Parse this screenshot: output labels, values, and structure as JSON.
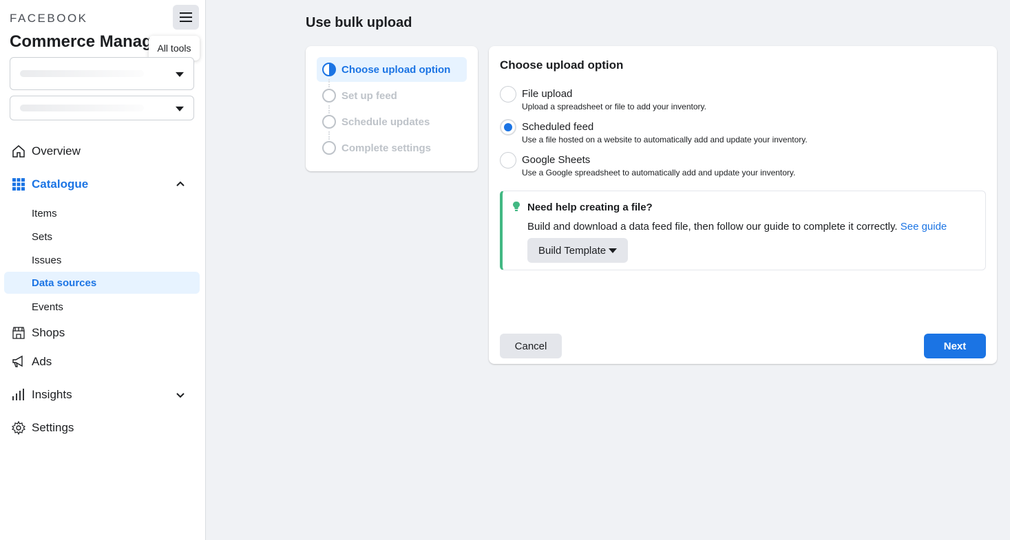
{
  "brand": "FACEBOOK",
  "app_title": "Commerce Manager",
  "tooltip": "All tools",
  "sidebar": {
    "nav": [
      {
        "label": "Overview",
        "icon": "home-icon"
      },
      {
        "label": "Catalogue",
        "icon": "grid-icon",
        "active": true,
        "expanded": true
      },
      {
        "label": "Shops",
        "icon": "shop-icon"
      },
      {
        "label": "Ads",
        "icon": "megaphone-icon"
      },
      {
        "label": "Insights",
        "icon": "bar-chart-icon"
      },
      {
        "label": "Settings",
        "icon": "gear-icon"
      }
    ],
    "catalogue_sub": [
      {
        "label": "Items"
      },
      {
        "label": "Sets"
      },
      {
        "label": "Issues"
      },
      {
        "label": "Data sources",
        "selected": true
      },
      {
        "label": "Events"
      }
    ]
  },
  "page_title": "Use bulk upload",
  "steps": [
    {
      "label": "Choose upload option",
      "state": "current"
    },
    {
      "label": "Set up feed",
      "state": "pending"
    },
    {
      "label": "Schedule updates",
      "state": "pending"
    },
    {
      "label": "Complete settings",
      "state": "pending"
    }
  ],
  "card": {
    "title": "Choose upload option",
    "options": [
      {
        "title": "File upload",
        "desc": "Upload a spreadsheet or file to add your inventory.",
        "selected": false
      },
      {
        "title": "Scheduled feed",
        "desc": "Use a file hosted on a website to automatically add and update your inventory.",
        "selected": true
      },
      {
        "title": "Google Sheets",
        "desc": "Use a Google spreadsheet to automatically add and update your inventory.",
        "selected": false
      }
    ],
    "help": {
      "title": "Need help creating a file?",
      "body": "Build and download a data feed file, then follow our guide to complete it correctly.",
      "link": "See guide",
      "button": "Build Template"
    },
    "cancel_label": "Cancel",
    "next_label": "Next"
  },
  "colors": {
    "accent": "#1b74e4",
    "help_border": "#42b883"
  }
}
